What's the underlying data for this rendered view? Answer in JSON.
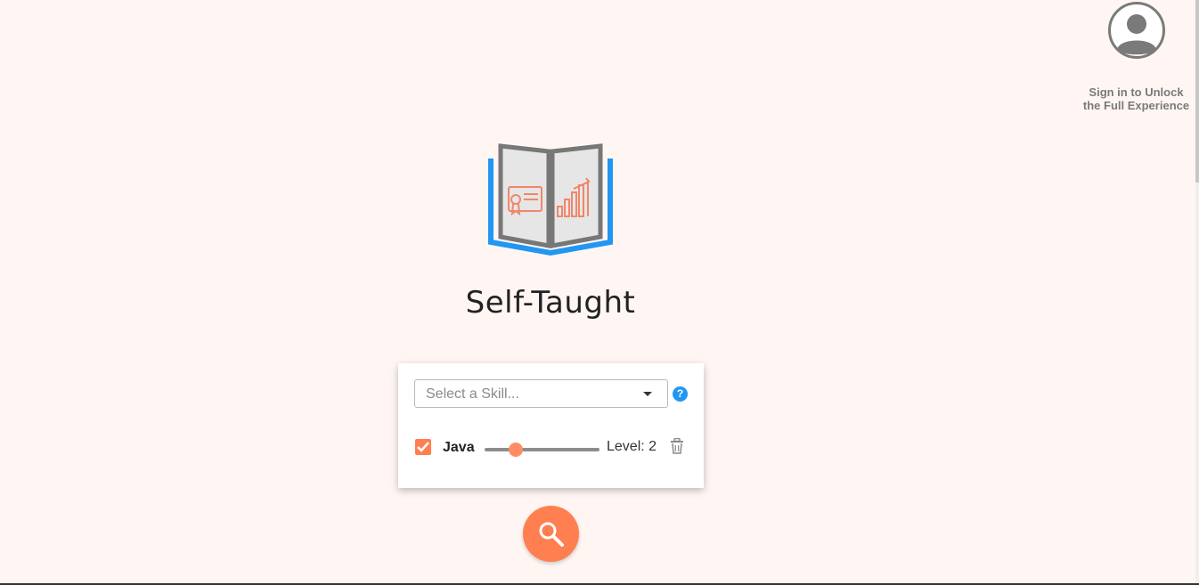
{
  "app": {
    "title": "Self-Taught"
  },
  "account": {
    "icon": "user-avatar-icon",
    "signin_line1": "Sign in to Unlock",
    "signin_line2": "the Full Experience"
  },
  "skill_picker": {
    "placeholder": "Select a Skill...",
    "help_label": "?"
  },
  "skills": [
    {
      "name": "Java",
      "checked": true,
      "level_label": "Level: 2",
      "level": 2,
      "level_fraction": 0.27
    }
  ],
  "search_button": {
    "icon": "search-icon"
  },
  "colors": {
    "background": "#fff6f3",
    "accent": "#ff7f50",
    "help_blue": "#2196f3",
    "logo_blue": "#2196f3",
    "logo_gray": "#777777"
  }
}
